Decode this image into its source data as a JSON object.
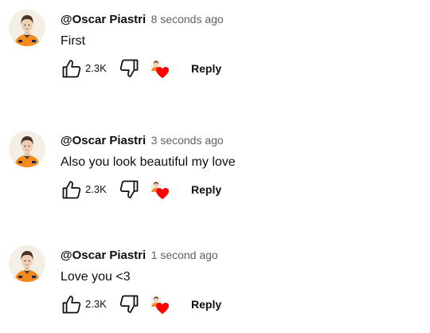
{
  "comments": [
    {
      "author": "@Oscar Piastri",
      "timestamp": "8 seconds ago",
      "text": "First",
      "like_count": "2.3K",
      "reply_label": "Reply"
    },
    {
      "author": "@Oscar Piastri",
      "timestamp": "3 seconds ago",
      "text": "Also you look beautiful my love",
      "like_count": "2.3K",
      "reply_label": "Reply"
    },
    {
      "author": "@Oscar Piastri",
      "timestamp": "1 second ago",
      "text": "Love you <3",
      "like_count": "2.3K",
      "reply_label": "Reply"
    }
  ],
  "icons": {
    "like": "thumbs-up-icon",
    "dislike": "thumbs-down-icon",
    "creator_heart": "creator-heart-icon"
  },
  "colors": {
    "text": "#0f0f0f",
    "secondary_text": "#606060",
    "heart": "#ff0000",
    "avatar_bg": "#f4efe4",
    "suit": "#f28a1e"
  }
}
